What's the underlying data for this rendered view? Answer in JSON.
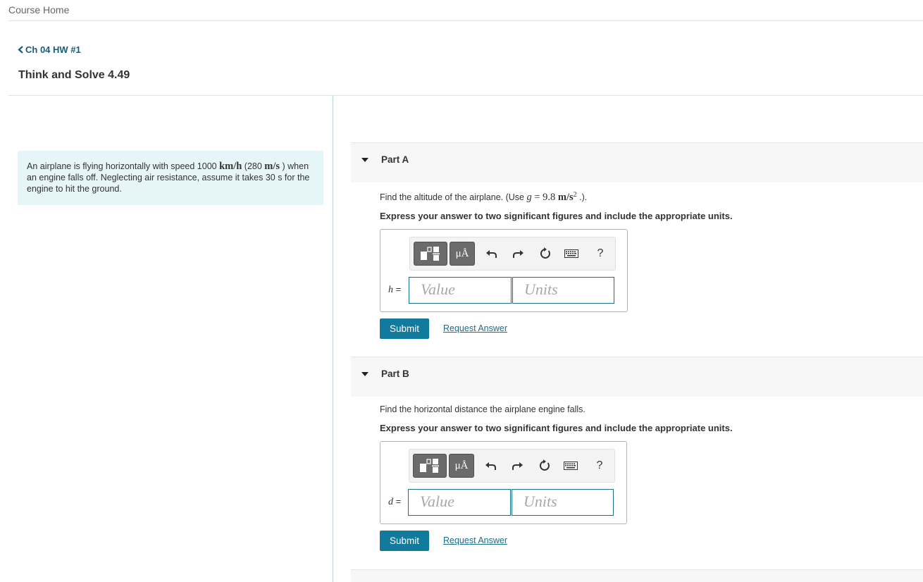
{
  "nav": {
    "course_home": "Course Home",
    "back_label": "Ch 04 HW #1"
  },
  "page": {
    "title": "Think and Solve 4.49"
  },
  "problem": {
    "text_1": "An airplane is flying horizontally with speed 1000 ",
    "speed_unit": "km/h",
    "text_2": " (280 ",
    "speed_unit_2": "m/s",
    "text_3": " ) when an engine falls off. Neglecting air resistance, assume it takes 30 s for the engine to hit the ground."
  },
  "parts": [
    {
      "label": "Part A",
      "question_prefix": "Find the altitude of the airplane. (Use ",
      "question_var": "g",
      "question_eq": " = 9.8 ",
      "question_unit": "m/s",
      "question_sup": "2",
      "question_suffix": " .).",
      "instruction": "Express your answer to two significant figures and include the appropriate units.",
      "variable": "h",
      "equals": " =",
      "value_placeholder": "Value",
      "units_placeholder": "Units",
      "submit_label": "Submit",
      "request_label": "Request Answer"
    },
    {
      "label": "Part B",
      "question": "Find the horizontal distance the airplane engine falls.",
      "instruction": "Express your answer to two significant figures and include the appropriate units.",
      "variable": "d",
      "equals": " =",
      "value_placeholder": "Value",
      "units_placeholder": "Units",
      "submit_label": "Submit",
      "request_label": "Request Answer"
    }
  ],
  "toolbar": {
    "units_button": "μÅ",
    "help": "?"
  },
  "colors": {
    "accent": "#127a9c",
    "link": "#1a6e8c",
    "problem_bg": "#e6f5f7"
  }
}
